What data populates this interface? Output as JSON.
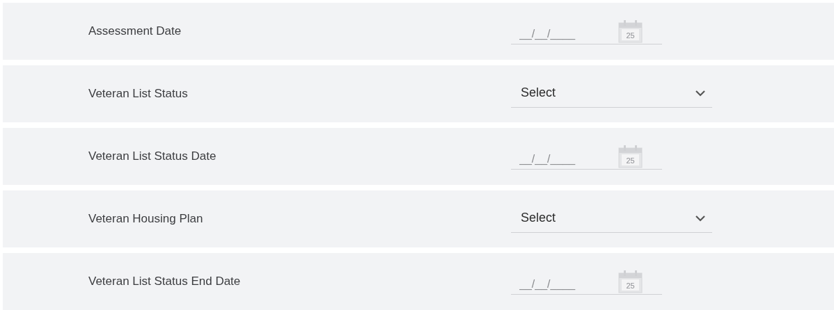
{
  "fields": [
    {
      "kind": "date",
      "label": "Assessment Date",
      "placeholder": "__/__/____",
      "calendar_day": "25"
    },
    {
      "kind": "select",
      "label": "Veteran List Status",
      "value": "Select"
    },
    {
      "kind": "date",
      "label": "Veteran List Status Date",
      "placeholder": "__/__/____",
      "calendar_day": "25"
    },
    {
      "kind": "select",
      "label": "Veteran Housing Plan",
      "value": "Select"
    },
    {
      "kind": "date",
      "label": "Veteran List Status End Date",
      "placeholder": "__/__/____",
      "calendar_day": "25"
    }
  ]
}
